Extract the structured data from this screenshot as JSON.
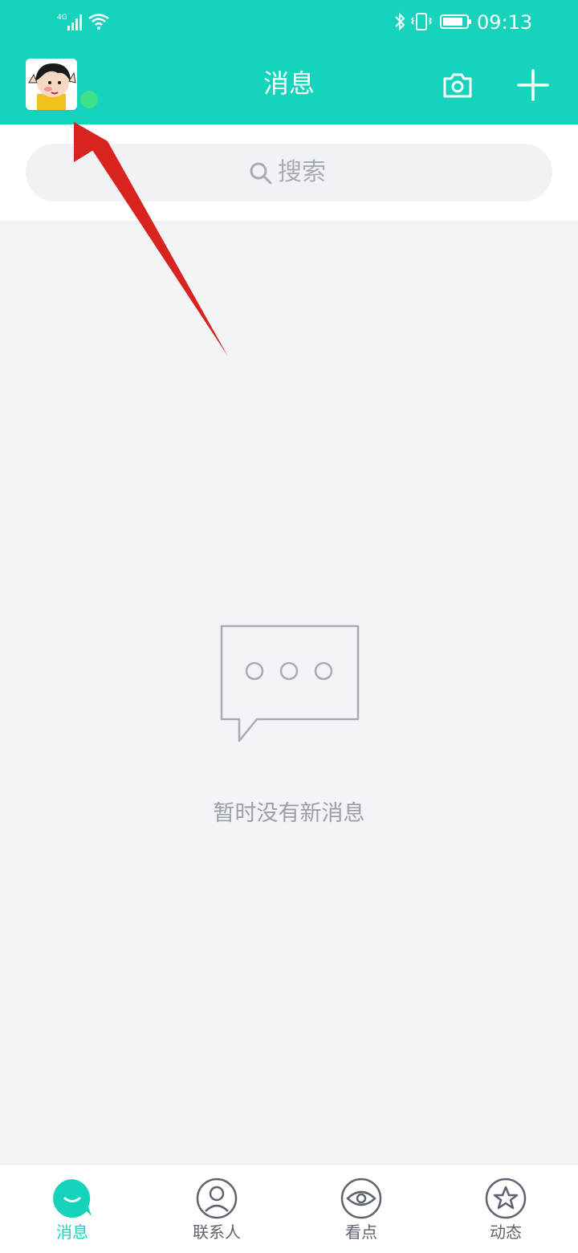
{
  "status_bar": {
    "network_type": "4G",
    "time": "09:13",
    "icons": [
      "signal-icon",
      "wifi-icon",
      "bluetooth-icon",
      "vibrate-icon",
      "battery-icon"
    ]
  },
  "header": {
    "title": "消息",
    "avatar_icon": "avatar-cartoon",
    "online_status_color": "#3ee08a",
    "actions": [
      "camera-icon",
      "plus-icon"
    ]
  },
  "search": {
    "placeholder": "搜索"
  },
  "empty_state": {
    "icon": "chat-bubble-icon",
    "text": "暂时没有新消息"
  },
  "bottom_nav": {
    "items": [
      {
        "label": "消息",
        "icon": "message-icon",
        "active": true
      },
      {
        "label": "联系人",
        "icon": "contacts-icon",
        "active": false
      },
      {
        "label": "看点",
        "icon": "eye-icon",
        "active": false
      },
      {
        "label": "动态",
        "icon": "star-icon",
        "active": false
      }
    ]
  },
  "colors": {
    "brand": "#16d3bc",
    "background": "#f3f4f8",
    "annotation_arrow": "#d9231f"
  }
}
